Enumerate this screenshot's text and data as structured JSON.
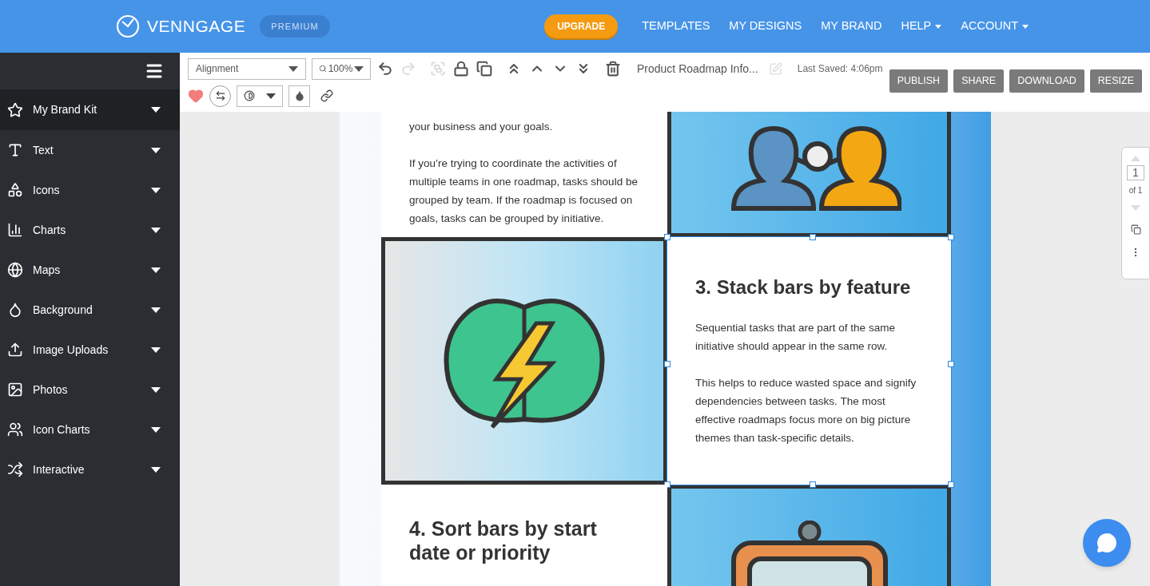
{
  "header": {
    "logo": "VENNGAGE",
    "plan_badge": "PREMIUM",
    "upgrade_button": "UPGRADE",
    "nav": [
      {
        "label": "TEMPLATES",
        "dropdown": false
      },
      {
        "label": "MY DESIGNS",
        "dropdown": false
      },
      {
        "label": "MY BRAND",
        "dropdown": false
      },
      {
        "label": "HELP",
        "dropdown": true
      },
      {
        "label": "ACCOUNT",
        "dropdown": true
      }
    ]
  },
  "sidebar": {
    "items": [
      {
        "label": "My Brand Kit",
        "kind": "star",
        "selected": true
      },
      {
        "label": "Text",
        "kind": "text",
        "selected": false
      },
      {
        "label": "Icons",
        "kind": "icons",
        "selected": false
      },
      {
        "label": "Charts",
        "kind": "charts",
        "selected": false
      },
      {
        "label": "Maps",
        "kind": "maps",
        "selected": false
      },
      {
        "label": "Background",
        "kind": "background",
        "selected": false
      },
      {
        "label": "Image Uploads",
        "kind": "upload",
        "selected": false
      },
      {
        "label": "Photos",
        "kind": "photos",
        "selected": false
      },
      {
        "label": "Icon Charts",
        "kind": "iconcharts",
        "selected": false
      },
      {
        "label": "Interactive",
        "kind": "interactive",
        "selected": false
      }
    ]
  },
  "toolbar": {
    "alignment_select": "Alignment",
    "zoom_select": "100%",
    "tools": [
      {
        "kind": "undo",
        "disabled": false
      },
      {
        "kind": "redo",
        "disabled": true
      },
      {
        "kind": "group",
        "disabled": true
      },
      {
        "kind": "lock",
        "disabled": false
      },
      {
        "kind": "duplicate",
        "disabled": false
      },
      {
        "kind": "front",
        "disabled": false
      },
      {
        "kind": "up",
        "disabled": false
      },
      {
        "kind": "down",
        "disabled": false
      },
      {
        "kind": "back",
        "disabled": false
      },
      {
        "kind": "delete",
        "disabled": false
      }
    ],
    "document_title": "Product Roadmap Info...",
    "rename_disabled": true,
    "last_saved": "Last Saved: 4:06pm",
    "actions": [
      "PUBLISH",
      "SHARE",
      "DOWNLOAD",
      "RESIZE"
    ]
  },
  "canvas": {
    "rows": [
      {
        "cells": [
          {
            "kind": "text",
            "selected": false,
            "paragraphs": [
              "your business and your goals.",
              "If you’re trying to coordinate the activities of multiple teams in one roadmap, tasks should be grouped by team. If the roadmap is focused on goals, tasks can be grouped by initiative."
            ]
          },
          {
            "kind": "people",
            "selected": false
          }
        ]
      },
      {
        "cells": [
          {
            "kind": "brain",
            "selected": false
          },
          {
            "kind": "text",
            "selected": true,
            "heading": "3. Stack bars by feature",
            "paragraphs": [
              "Sequential tasks that are part of the same initiative should appear in the same row.",
              "This helps to reduce wasted space and signify dependencies between tasks. The most effective roadmaps focus more on big picture themes than task-specific details."
            ]
          }
        ]
      },
      {
        "cells": [
          {
            "kind": "text",
            "selected": false,
            "heading": "4. Sort bars by start date or priority"
          },
          {
            "kind": "clock",
            "selected": false
          }
        ]
      }
    ]
  },
  "page_nav": {
    "page": "1",
    "total": "of 1"
  }
}
